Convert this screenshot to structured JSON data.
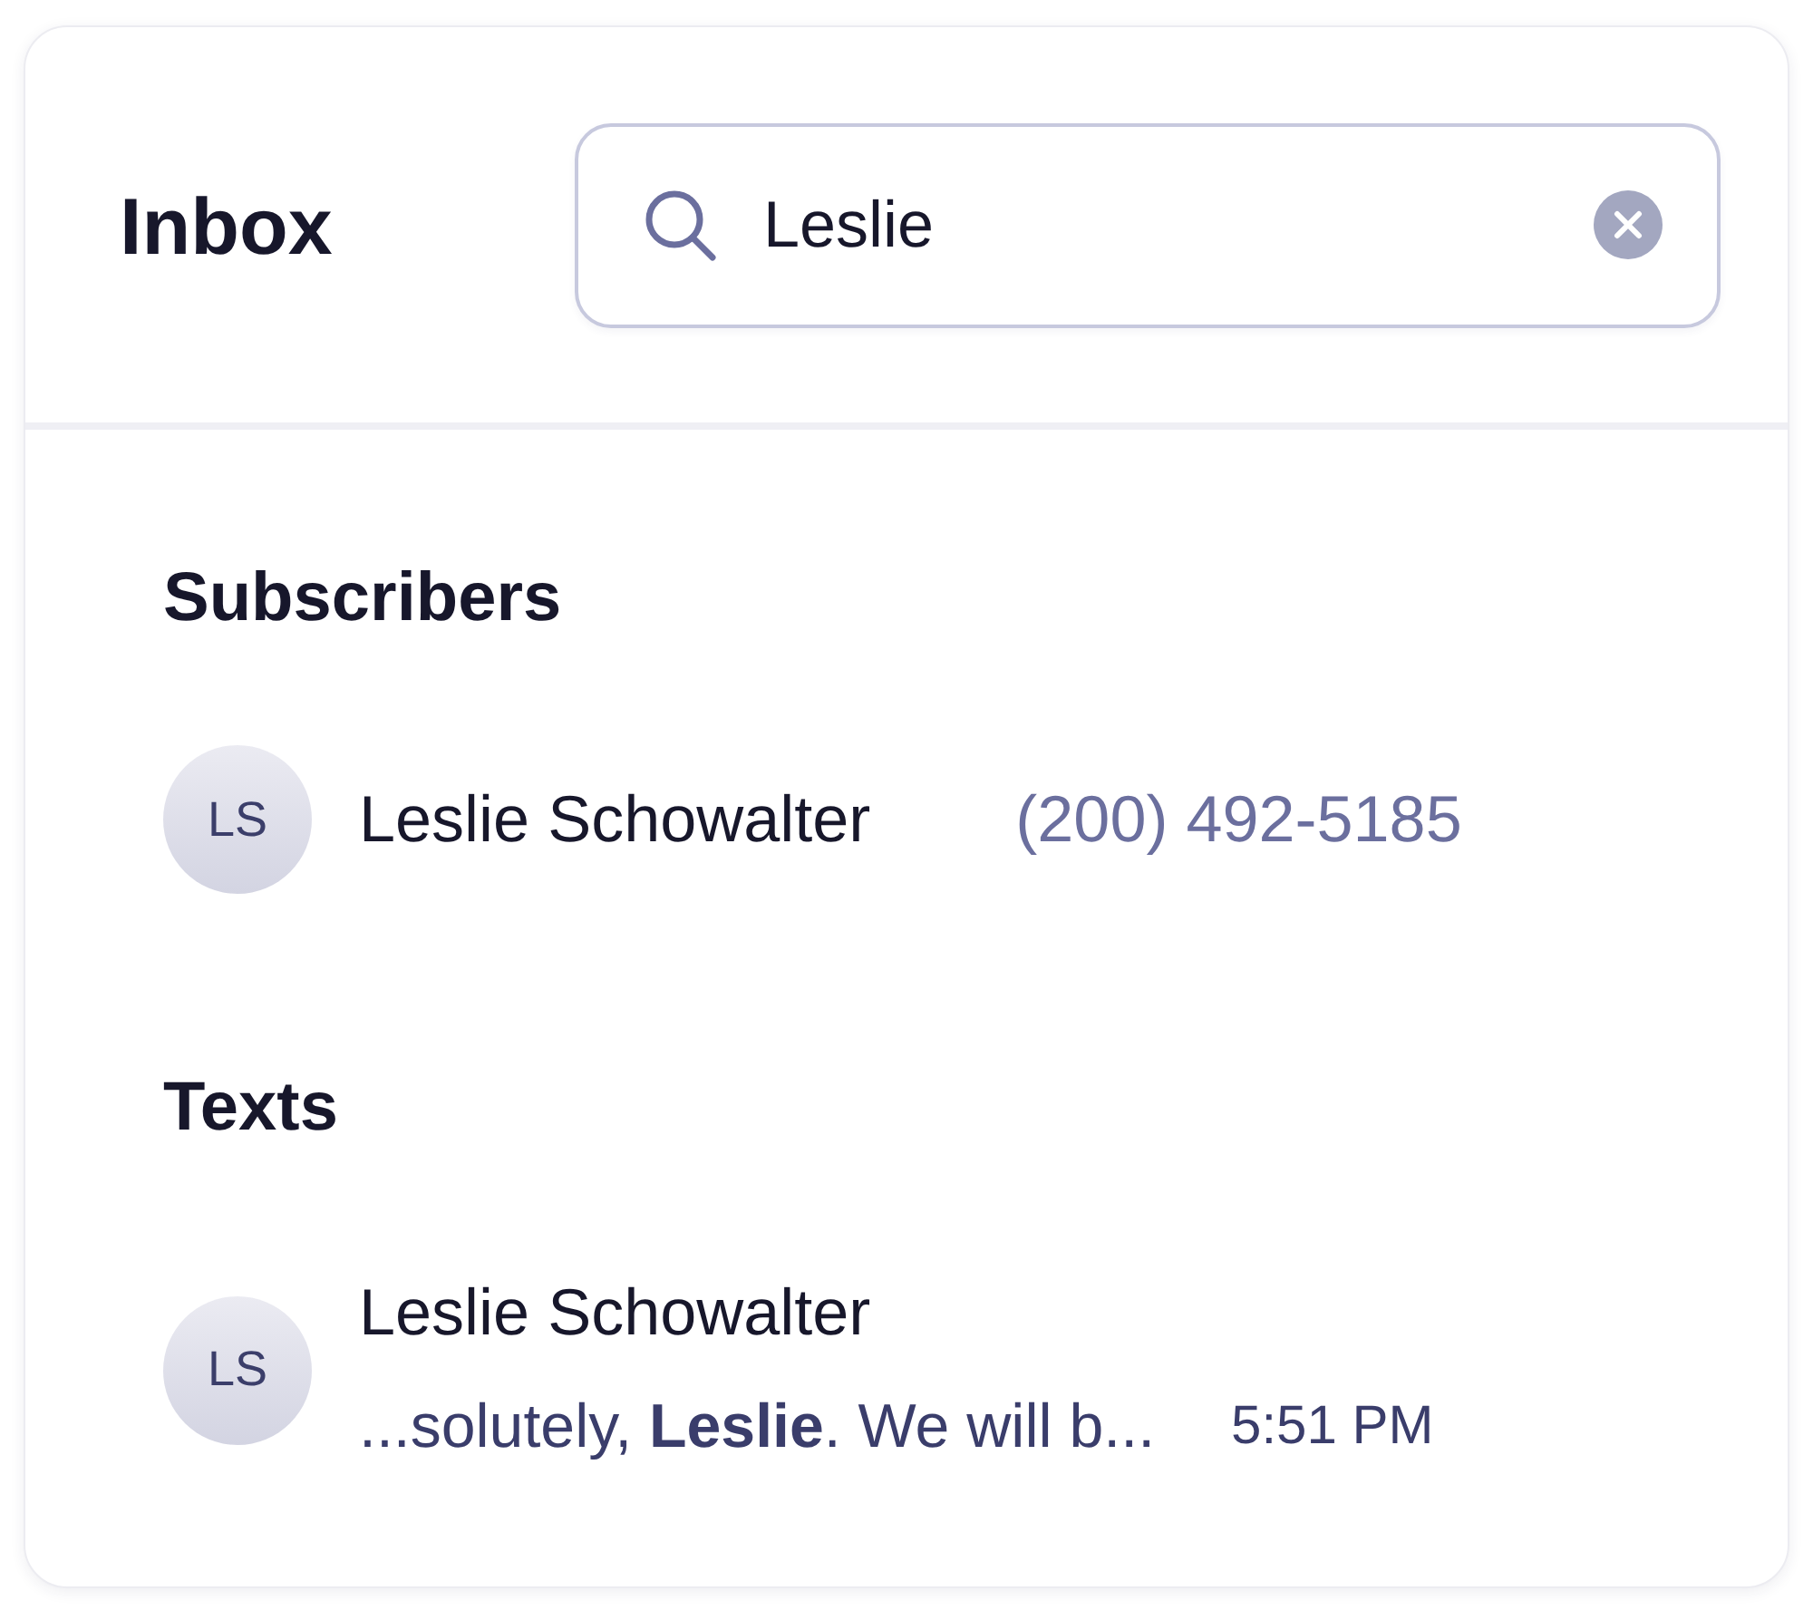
{
  "header": {
    "title": "Inbox",
    "search": {
      "value": "Leslie"
    }
  },
  "sections": [
    {
      "title": "Subscribers",
      "kind": "contacts",
      "results": [
        {
          "initials": "LS",
          "name": "Leslie Schowalter",
          "phone": "(200) 492-5185"
        }
      ]
    },
    {
      "title": "Texts",
      "kind": "messages",
      "results": [
        {
          "initials": "LS",
          "name": "Leslie Schowalter",
          "preview": "...solutely, **Leslie**. We will b...",
          "time": "5:51 PM"
        }
      ]
    }
  ]
}
